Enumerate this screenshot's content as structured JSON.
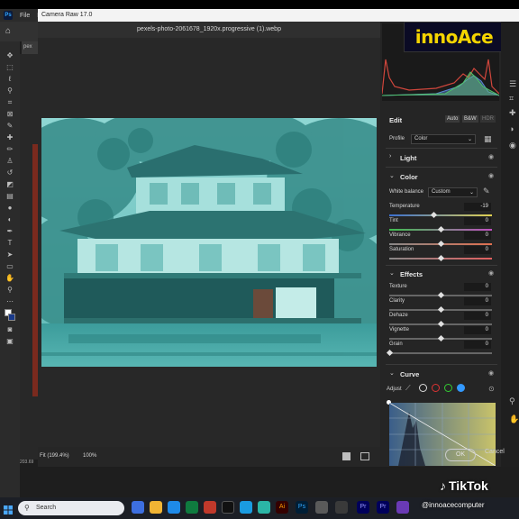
{
  "ps": {
    "menu": [
      "File",
      "Ed"
    ],
    "doc_tab": "pex",
    "status_text": "203.69"
  },
  "camera_raw": {
    "window_title": "Camera Raw 17.0",
    "filename": "pexels-photo-2061678_1920x.progressive (1).webp",
    "zoom_fit_label": "Fit (199.4%)",
    "zoom_percent": "100%",
    "ok_label": "OK",
    "cancel_label": "Cancel",
    "logo": "innoAce",
    "edit": {
      "title": "Edit",
      "auto_label": "Auto",
      "bw_label": "B&W",
      "hdr_label": "HDR",
      "profile_label": "Profile",
      "profile_value": "Color"
    },
    "light": {
      "title": "Light"
    },
    "color": {
      "title": "Color",
      "white_balance_label": "White balance",
      "white_balance_value": "Custom",
      "sliders": [
        {
          "label": "Temperature",
          "value": "-19",
          "fraction": 0.43
        },
        {
          "label": "Tint",
          "value": "0",
          "fraction": 0.5
        },
        {
          "label": "Vibrance",
          "value": "0",
          "fraction": 0.5
        },
        {
          "label": "Saturation",
          "value": "0",
          "fraction": 0.5
        }
      ]
    },
    "effects": {
      "title": "Effects",
      "sliders": [
        {
          "label": "Texture",
          "value": "0",
          "fraction": 0.5
        },
        {
          "label": "Clarity",
          "value": "0",
          "fraction": 0.5
        },
        {
          "label": "Dehaze",
          "value": "0",
          "fraction": 0.5
        },
        {
          "label": "Vignette",
          "value": "0",
          "fraction": 0.5
        },
        {
          "label": "Grain",
          "value": "0",
          "fraction": 0.0
        }
      ]
    },
    "curve": {
      "title": "Curve",
      "adjust_label": "Adjust"
    }
  },
  "tiktok": {
    "brand": "TikTok",
    "user": "@innoacecomputer"
  },
  "taskbar": {
    "search_placeholder": "Search"
  },
  "colors": {
    "photo_tint": "#4fb0ae",
    "logo_yellow": "#f5d400"
  }
}
